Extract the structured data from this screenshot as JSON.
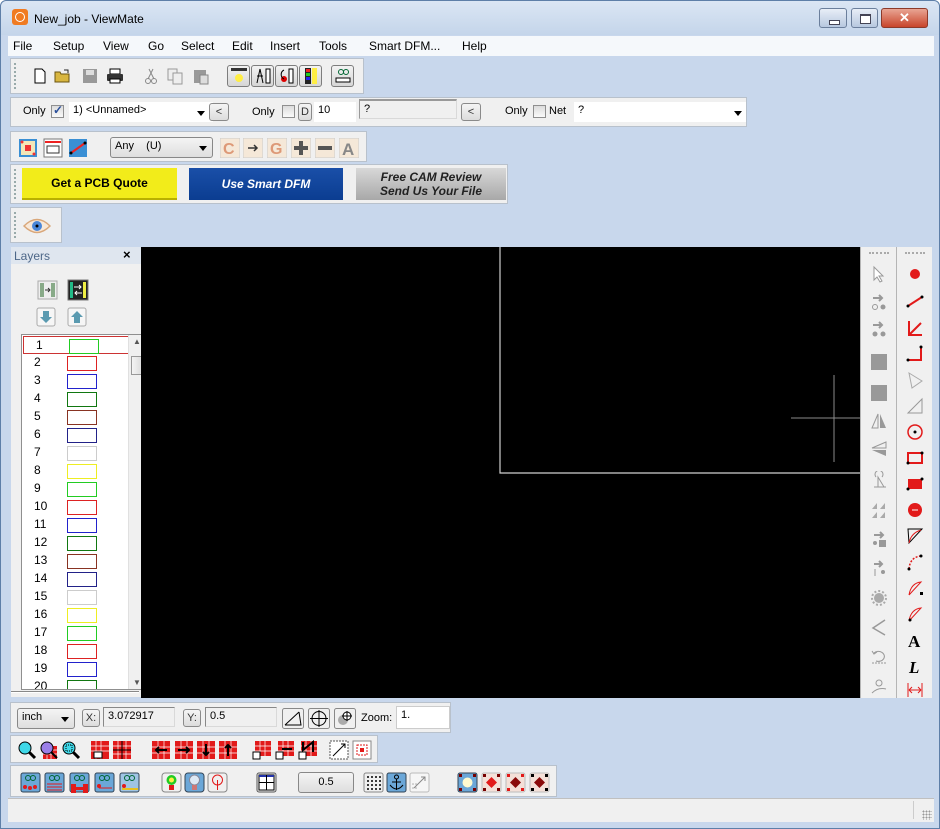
{
  "window": {
    "title": "New_job - ViewMate",
    "controls": {
      "minimize": "minimize",
      "maximize": "maximize",
      "close": "close"
    }
  },
  "menu": [
    "File",
    "Setup",
    "View",
    "Go",
    "Select",
    "Edit",
    "Insert",
    "Tools",
    "Smart DFM...",
    "Help"
  ],
  "standard_toolbar": {
    "icons": [
      "new-file-icon",
      "open-folder-icon",
      "save-icon",
      "print-icon",
      "cut-icon",
      "copy-icon",
      "paste-icon",
      "highlight-icon",
      "measure-icon",
      "net-icon",
      "layer-colors-icon",
      "view-glasses-icon"
    ]
  },
  "filter_bar": {
    "layer_only_label": "Only",
    "layer_only_checked": true,
    "layer_select_value": "1) <Unnamed>",
    "prev_button": "<",
    "dcode_only_label": "Only",
    "dcode_only_checked": false,
    "dcode_label": "D",
    "dcode_value": "10",
    "dcode_desc_value": "?",
    "net_prev_button": "<",
    "net_only_label": "Only",
    "net_only_checked": false,
    "net_label": "Net",
    "net_select_value": "?"
  },
  "select_bar": {
    "type_select_value": "Any    (U)",
    "icons": [
      "select-window-icon",
      "select-layer-icon",
      "select-line-icon",
      "c-icon",
      "arrow-point-icon",
      "g-icon",
      "plus-icon",
      "minus-icon",
      "a-icon"
    ]
  },
  "ads": {
    "quote": "Get a PCB Quote",
    "dfm": "Use Smart DFM",
    "review_line1": "Free CAM Review",
    "review_line2": "Send Us Your File"
  },
  "view_bar": {
    "icon": "eye-icon"
  },
  "layers_panel": {
    "title": "Layers",
    "close": "×",
    "layers": [
      {
        "num": "1",
        "color": "#22cc22",
        "selected": true
      },
      {
        "num": "2",
        "color": "#dd2222"
      },
      {
        "num": "3",
        "color": "#2222cc"
      },
      {
        "num": "4",
        "color": "#117711"
      },
      {
        "num": "5",
        "color": "#883322"
      },
      {
        "num": "6",
        "color": "#222288"
      },
      {
        "num": "7",
        "color": "#cccccc"
      },
      {
        "num": "8",
        "color": "#eeee22"
      },
      {
        "num": "9",
        "color": "#22cc22"
      },
      {
        "num": "10",
        "color": "#dd2222"
      },
      {
        "num": "11",
        "color": "#2222cc"
      },
      {
        "num": "12",
        "color": "#117711"
      },
      {
        "num": "13",
        "color": "#883322"
      },
      {
        "num": "14",
        "color": "#222288"
      },
      {
        "num": "15",
        "color": "#cccccc"
      },
      {
        "num": "16",
        "color": "#eeee22"
      },
      {
        "num": "17",
        "color": "#22cc22"
      },
      {
        "num": "18",
        "color": "#dd2222"
      },
      {
        "num": "19",
        "color": "#2222cc"
      },
      {
        "num": "20",
        "color": "#117711"
      }
    ]
  },
  "coord_bar": {
    "units_value": "inch",
    "x_label": "X:",
    "x_value": "3.072917",
    "y_label": "Y:",
    "y_value": "0.5",
    "zoom_label": "Zoom:",
    "zoom_value": "1."
  },
  "bottom_bar": {
    "grid_value": "0.5"
  },
  "colors": {
    "canvas": "#000000",
    "accent_red": "#e21a1a",
    "ad_yellow": "#f2ec1a",
    "ad_blue": "#0b3d91"
  }
}
